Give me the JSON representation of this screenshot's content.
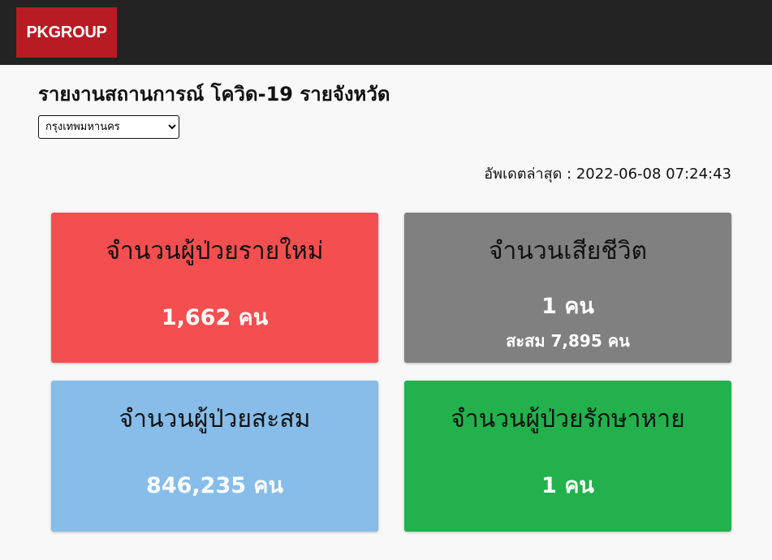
{
  "header": {
    "logo_text": "PKGROUP",
    "logo_color": "#b71c24",
    "bar_color": "#232323"
  },
  "page": {
    "title": "รายงานสถานการณ์ โควิด-19 รายจังหวัด",
    "province_selected": "กรุงเทพมหานคร",
    "updated_label": "อัพเดตล่าสุด : 2022-06-08 07:24:43"
  },
  "cards": {
    "new_cases": {
      "title": "จำนวนผู้ป่วยรายใหม่",
      "value": "1,662 คน",
      "color": "#f44f50"
    },
    "deaths": {
      "title": "จำนวนเสียชีวิต",
      "value": "1 คน",
      "cumulative": "สะสม 7,895 คน",
      "color": "#808080"
    },
    "total_cases": {
      "title": "จำนวนผู้ป่วยสะสม",
      "value": "846,235 คน",
      "color": "#87bde8"
    },
    "recovered": {
      "title": "จำนวนผู้ป่วยรักษาหาย",
      "value": "1 คน",
      "color": "#22b14c"
    }
  }
}
